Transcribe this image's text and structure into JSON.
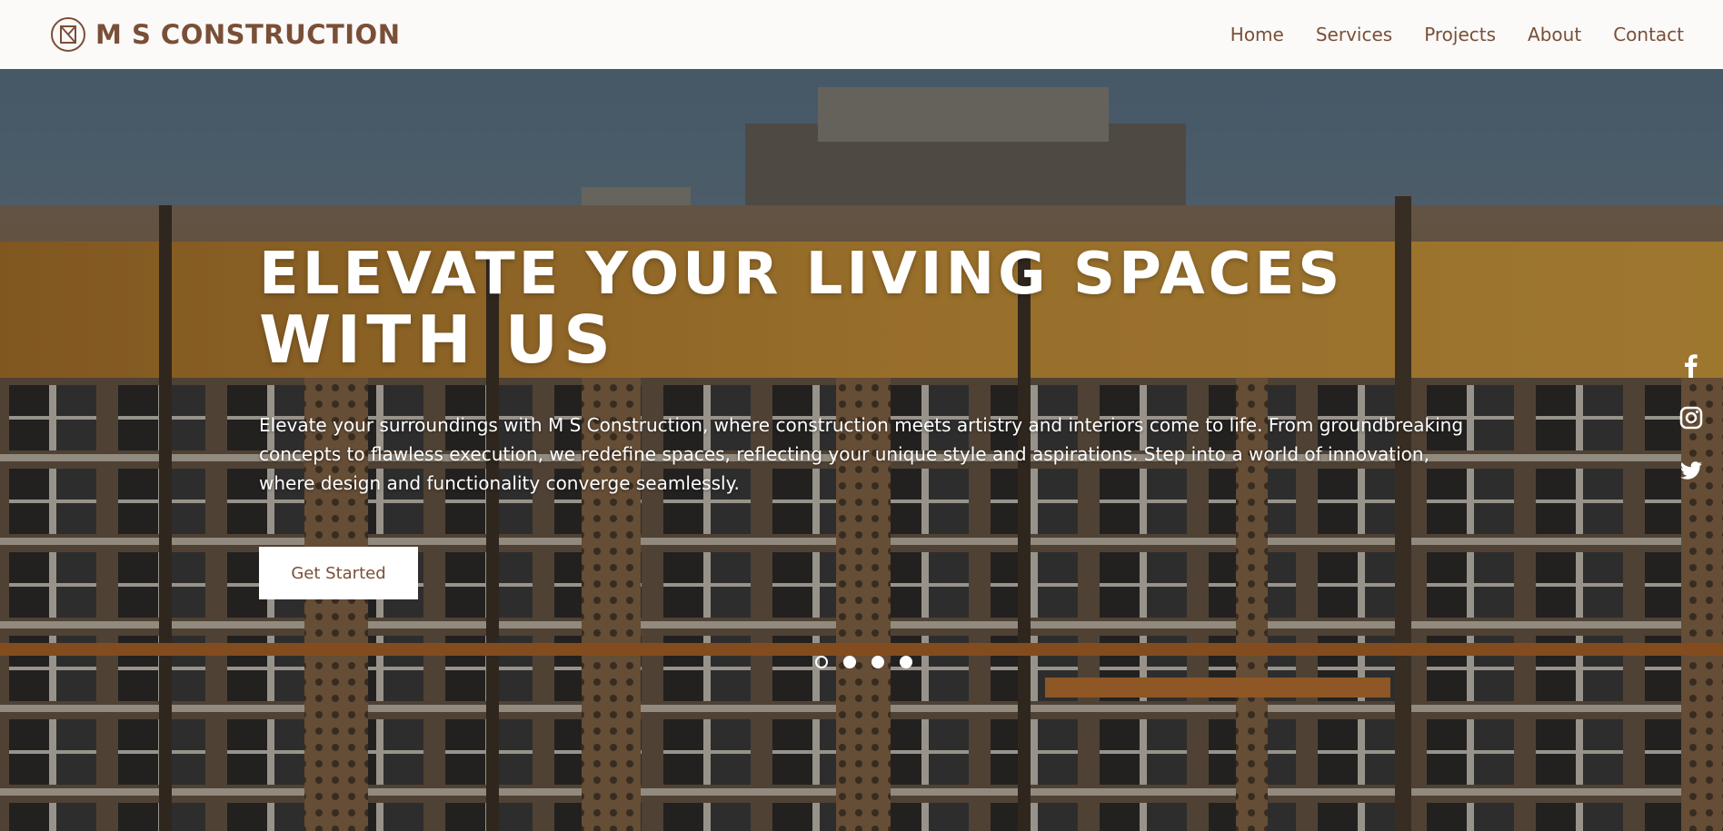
{
  "header": {
    "brand_name": "M S CONSTRUCTION",
    "logo_icon": "ms-monogram-icon",
    "nav": [
      {
        "label": "Home"
      },
      {
        "label": "Services"
      },
      {
        "label": "Projects"
      },
      {
        "label": "About"
      },
      {
        "label": "Contact"
      }
    ]
  },
  "hero": {
    "title_line1": "ELEVATE YOUR LIVING SPACES",
    "title_line2": "WITH US",
    "description": "Elevate your surroundings with M S Construction, where construction meets artistry and interiors come to life. From groundbreaking concepts to flawless execution, we redefine spaces, reflecting your unique style and aspirations. Step into a world of innovation, where design and functionality converge seamlessly.",
    "cta_label": "Get Started",
    "background_image": "building-facade-photo",
    "slides_total": 4,
    "active_slide": 1
  },
  "social": [
    {
      "icon": "facebook-icon"
    },
    {
      "icon": "instagram-icon"
    },
    {
      "icon": "twitter-icon"
    }
  ],
  "colors": {
    "brand": "#7a4f37",
    "header_bg": "#fbfaf9",
    "hero_text": "#ffffff"
  }
}
